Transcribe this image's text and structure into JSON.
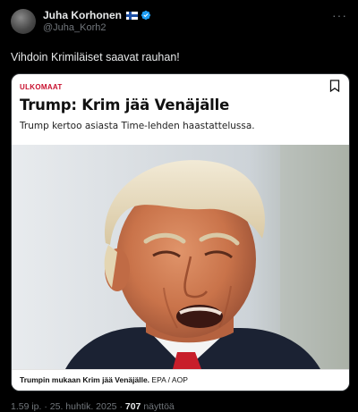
{
  "author": {
    "name": "Juha Korhonen",
    "handle": "@Juha_Korh2",
    "flag_icon": "finland-flag-icon",
    "verified_icon": "verified-badge-icon"
  },
  "menu_icon_label": "···",
  "tweet_text": "Vihdoin Krimiläiset saavat rauhan!",
  "card": {
    "section": "ULKOMAAT",
    "headline": "Trump: Krim jää Venäjälle",
    "lead": "Trump kertoo asiasta Time-lehden haastattelussa.",
    "caption_bold": "Trumpin mukaan Krim jää Venäjälle.",
    "caption_credit": "EPA / AOP"
  },
  "meta": {
    "time": "1.59 ip.",
    "separator": "·",
    "date": "25. huhtik. 2025",
    "views_count": "707",
    "views_label": "näyttöä"
  },
  "colors": {
    "background": "#000000",
    "text": "#e7e9ea",
    "muted": "#71767b",
    "verified": "#1d9bf0",
    "section_red": "#c8102e"
  }
}
